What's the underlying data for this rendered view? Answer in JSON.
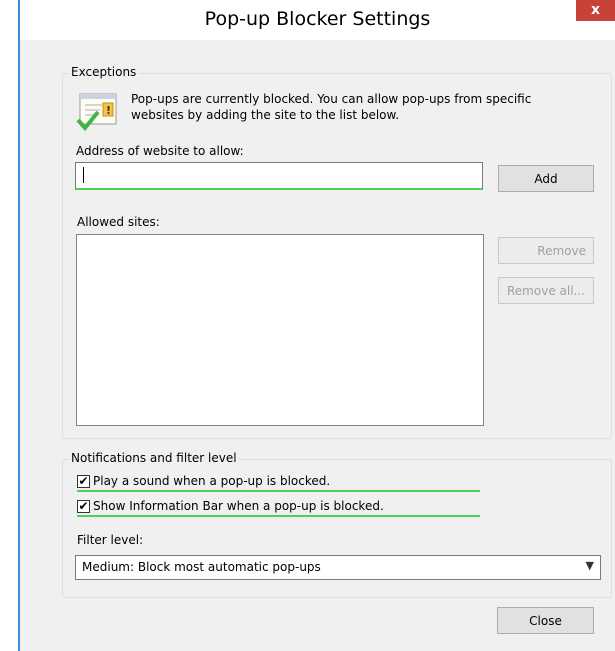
{
  "window": {
    "title": "Pop-up Blocker Settings",
    "close_glyph": "x"
  },
  "exceptions": {
    "group_label": "Exceptions",
    "info_line1": "Pop-ups are currently blocked.  You can allow pop-ups from specific",
    "info_line2": "websites by adding the site to the list below.",
    "address_label": "Address of website to allow:",
    "address_value": "",
    "add_button": "Add",
    "allowed_label": "Allowed sites:",
    "allowed_sites": [],
    "remove_button": "Remove",
    "remove_all_button": "Remove all..."
  },
  "notifications": {
    "group_label": "Notifications and filter level",
    "play_sound": {
      "label": "Play a sound when a pop-up is blocked.",
      "checked": true
    },
    "show_info_bar": {
      "label": "Show Information Bar when a pop-up is blocked.",
      "checked": true
    },
    "filter_label": "Filter level:",
    "filter_selected": "Medium: Block most automatic pop-ups"
  },
  "footer": {
    "close_button": "Close"
  },
  "colors": {
    "title_accent": "#3b8fd8",
    "close_red": "#c8423a",
    "focus_green": "#4fcf55"
  },
  "icons": {
    "info": "popup-info-icon",
    "check": "checkmark-icon",
    "dropdown": "chevron-down-icon"
  }
}
